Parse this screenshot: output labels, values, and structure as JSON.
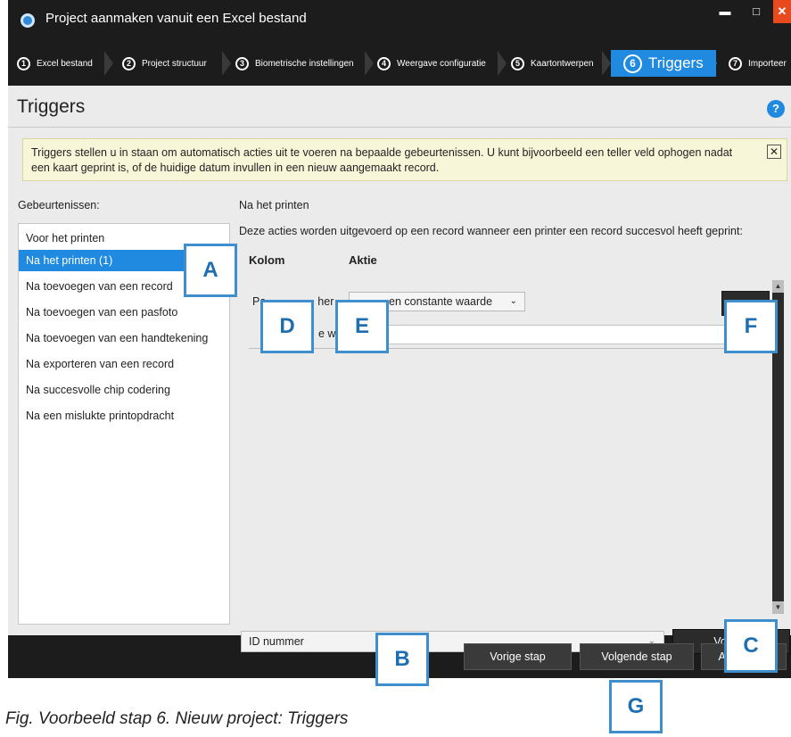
{
  "window": {
    "title": "Project aanmaken vanuit een Excel bestand",
    "controls": {
      "minimize": "▬",
      "maximize": "□",
      "close": "✕"
    }
  },
  "wizard": {
    "steps": [
      {
        "num": "1",
        "label": "Excel bestand"
      },
      {
        "num": "2",
        "label": "Project structuur"
      },
      {
        "num": "3",
        "label": "Biometrische instellingen"
      },
      {
        "num": "4",
        "label": "Weergave configuratie"
      },
      {
        "num": "5",
        "label": "Kaartontwerpen"
      },
      {
        "num": "6",
        "label": "Triggers"
      },
      {
        "num": "7",
        "label": "Importeer"
      }
    ],
    "active_step": "6"
  },
  "page": {
    "title": "Triggers",
    "help_icon": "?",
    "info": "Triggers stellen u in staan om automatisch acties uit te voeren na bepaalde gebeurtenissen. U kunt bijvoorbeeld een teller veld ophogen nadat een kaart geprint is, of de huidige datum invullen in een nieuw aangemaakt record.",
    "info_close": "✕"
  },
  "events": {
    "label": "Gebeurtenissen:",
    "items": [
      "Voor het printen",
      "Na het printen (1)",
      "Na toevoegen van een record",
      "Na toevoegen van een pasfoto",
      "Na toevoegen van een handtekening",
      "Na exporteren van een record",
      "Na succesvolle chip codering",
      "Na een mislukte printopdracht"
    ],
    "selected_index": 1
  },
  "detail": {
    "title": "Na het printen",
    "description": "Deze acties worden uitgevoerd op een record wanneer een printer een record succesvol heeft geprint:",
    "col_kolom": "Kolom",
    "col_aktie": "Aktie",
    "row": {
      "kolom_partial": "Pa",
      "kolom_partial_end": "her",
      "action": "en constante waarde",
      "value_label_partial": "e wa"
    }
  },
  "bottom": {
    "column_select": "ID nummer",
    "add_trigger": "Voeg tr"
  },
  "footer": {
    "prev": "Vorige stap",
    "next": "Volgende stap",
    "cancel": "Annuleren"
  },
  "callouts": {
    "a": "A",
    "b": "B",
    "c": "C",
    "d": "D",
    "e": "E",
    "f": "F",
    "g": "G"
  },
  "caption": "Fig. Voorbeeld stap 6. Nieuw project: Triggers",
  "colors": {
    "accent": "#1f8ae0",
    "titlebar": "#1c1c1c",
    "info_bg": "#f8f6d8",
    "callout_border": "#3f8fcf"
  }
}
